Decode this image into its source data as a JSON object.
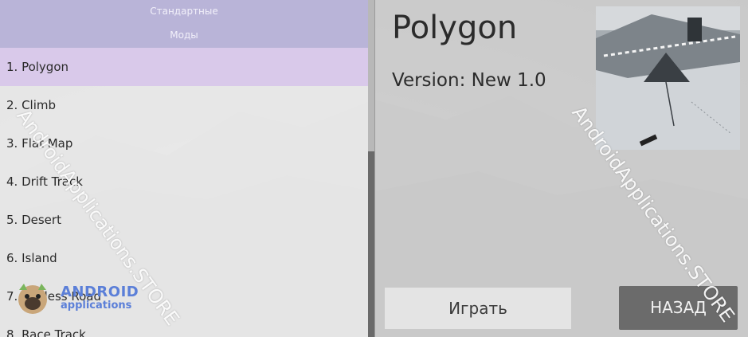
{
  "header": {
    "line1": "Стандартные",
    "line2": "Моды"
  },
  "maps": [
    {
      "label": "1. Polygon",
      "selected": true
    },
    {
      "label": "2. Climb"
    },
    {
      "label": "3. Flat Map"
    },
    {
      "label": "4. Drift Track"
    },
    {
      "label": "5. Desert"
    },
    {
      "label": "6. Island"
    },
    {
      "label": "7. Endless Road"
    },
    {
      "label": "8. Race Track"
    }
  ],
  "detail": {
    "title": "Polygon",
    "version": "Version: New 1.0"
  },
  "buttons": {
    "play": "Играть",
    "back": "НАЗАД"
  },
  "watermark": "AndroidApplications.STORE",
  "logo": {
    "line1": "ANDROID",
    "line2": "applications"
  },
  "colors": {
    "header_bg": "#b9b4d8",
    "selected_bg": "#d9c9ea",
    "back_button_bg": "#6b6b6b",
    "logo_text": "#5b7fd8"
  }
}
